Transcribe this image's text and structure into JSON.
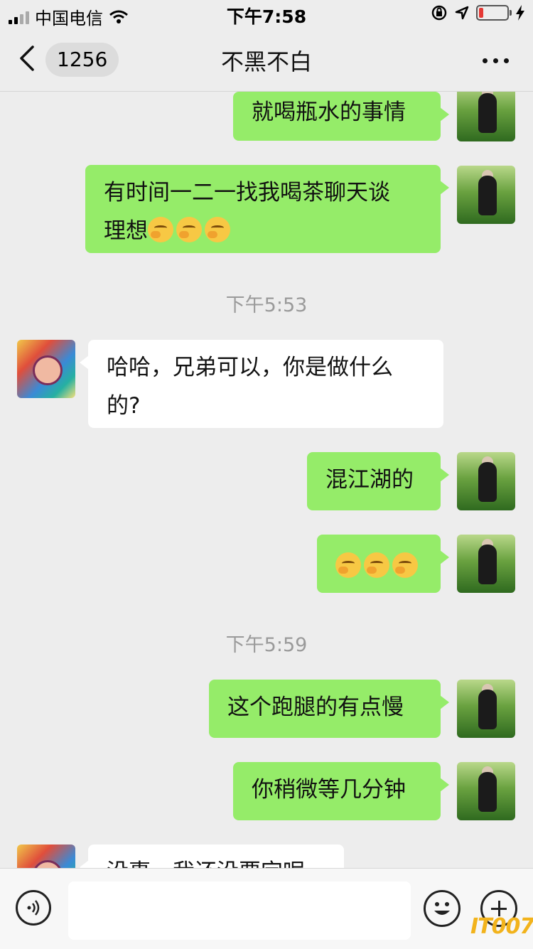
{
  "status_bar": {
    "carrier": "中国电信",
    "time": "下午7:58",
    "battery_level": 0.15,
    "icons": [
      "signal-icon",
      "wifi-icon",
      "orientation-lock-icon",
      "location-icon",
      "battery-icon",
      "charging-icon"
    ]
  },
  "header": {
    "back_icon": "chevron-left-icon",
    "unread_count": "1256",
    "title": "不黑不白",
    "more_icon": "more-dots-icon"
  },
  "messages": [
    {
      "from": "me",
      "text": "就喝瓶水的事情"
    },
    {
      "from": "me",
      "text_line1": "有时间一二一找我喝茶聊天谈",
      "text_line2_prefix": "理想",
      "emoji_count": 3,
      "emoji_name": "facepalm-grin-emoji"
    },
    {
      "type": "time",
      "text": "下午5:53"
    },
    {
      "from": "other",
      "text_line1": "哈哈，兄弟可以，你是做什么",
      "text_line2": "的?"
    },
    {
      "from": "me",
      "text": "混江湖的"
    },
    {
      "from": "me",
      "emoji_count": 3,
      "emoji_name": "facepalm-grin-emoji"
    },
    {
      "type": "time",
      "text": "下午5:59"
    },
    {
      "from": "me",
      "text": "这个跑腿的有点慢"
    },
    {
      "from": "me",
      "text": "你稍微等几分钟"
    },
    {
      "from": "other",
      "text": "没事，我还没要定呢"
    }
  ],
  "input_bar": {
    "voice_icon": "voice-icon",
    "text_value": "",
    "emoji_icon": "emoji-smile-icon",
    "plus_icon": "plus-icon"
  },
  "watermark": "IT007",
  "colors": {
    "background": "#ededed",
    "my_bubble": "#95ec69",
    "other_bubble": "#ffffff",
    "timestamp": "#9a9a9a",
    "watermark": "#f2b31c"
  }
}
